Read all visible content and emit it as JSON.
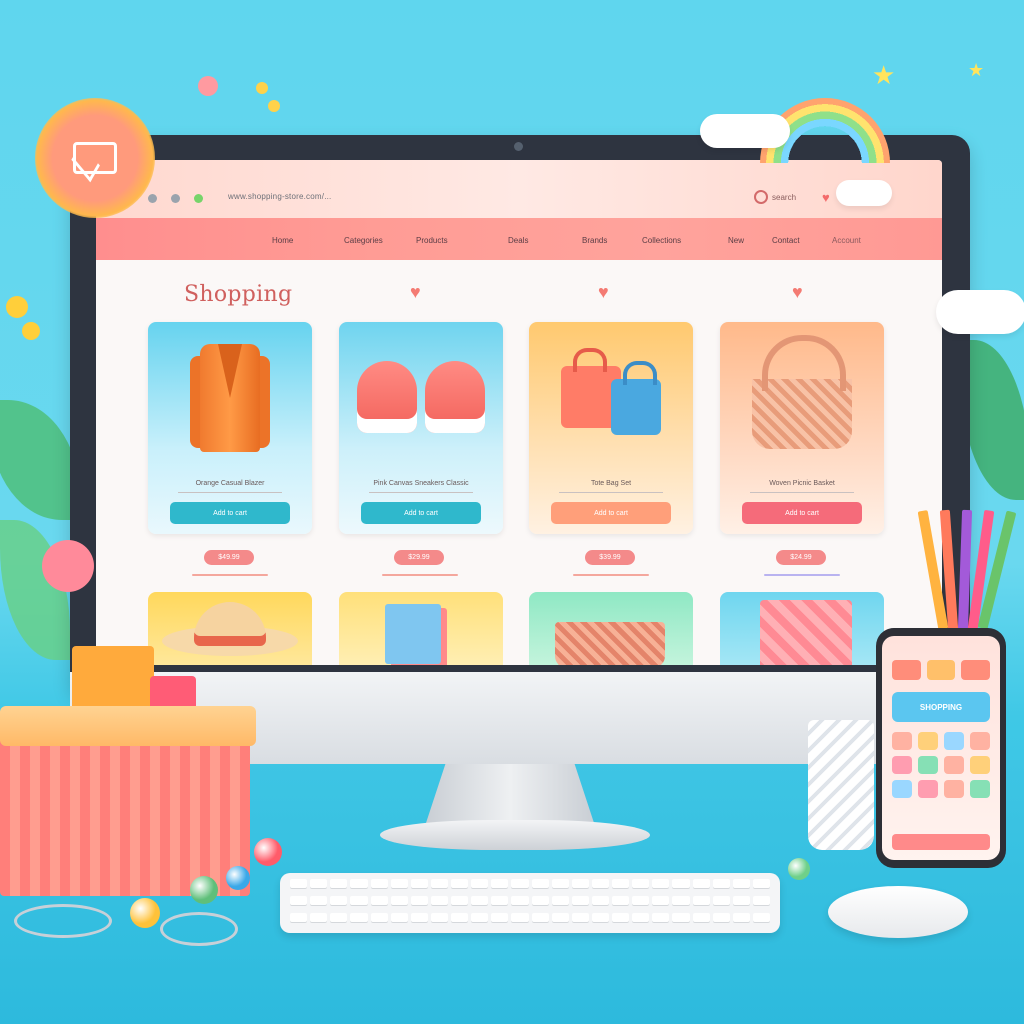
{
  "browser": {
    "url": "www.shopping-store.com/...",
    "search_label": "search"
  },
  "nav": {
    "items": [
      "Home",
      "Categories",
      "Products",
      "Deals",
      "Brands",
      "Collections",
      "New",
      "Contact",
      "Account"
    ]
  },
  "page": {
    "title": "Shopping"
  },
  "products": [
    {
      "name": "Orange Casual Blazer",
      "button": "Add to cart",
      "price": "$49.99",
      "art": "jacket-icon"
    },
    {
      "name": "Pink Canvas Sneakers Classic",
      "button": "Add to cart",
      "price": "$29.99",
      "art": "sneakers-icon"
    },
    {
      "name": "Tote Bag Set",
      "button": "Add to cart",
      "price": "$39.99",
      "art": "bags-icon"
    },
    {
      "name": "Woven Picnic Basket",
      "button": "Add to cart",
      "price": "$24.99",
      "art": "basket-icon"
    }
  ],
  "second_row": [
    "hat-icon",
    "notebook-icon",
    "basket-icon",
    "gift-box-icon"
  ],
  "phone": {
    "banner": "SHOPPING"
  },
  "colors": {
    "nav": "#ff9c95",
    "title": "#d0605e",
    "btn_teal": "#2fb8cc",
    "btn_orange": "#ff9f7a",
    "btn_pink": "#f56b7a"
  }
}
